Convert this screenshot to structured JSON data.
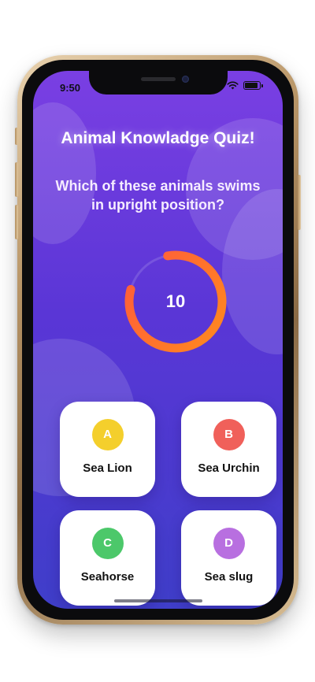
{
  "status_bar": {
    "time": "9:50"
  },
  "quiz": {
    "title": "Animal Knowladge Quiz!",
    "question": "Which of these animals swims in upright position?",
    "timer": {
      "value": "10",
      "progress_fraction": 0.82,
      "ring_colors": [
        "#ff5a3c",
        "#ff8a1e"
      ]
    }
  },
  "answers": [
    {
      "letter": "A",
      "label": "Sea Lion",
      "badge_color": "#f4cf2c"
    },
    {
      "letter": "B",
      "label": "Sea Urchin",
      "badge_color": "#f0605a"
    },
    {
      "letter": "C",
      "label": "Seahorse",
      "badge_color": "#4cc86a"
    },
    {
      "letter": "D",
      "label": "Sea slug",
      "badge_color": "#b86fe0"
    }
  ],
  "theme": {
    "gradient_top": "#7a3fe3",
    "gradient_bottom": "#3f3ec9"
  }
}
